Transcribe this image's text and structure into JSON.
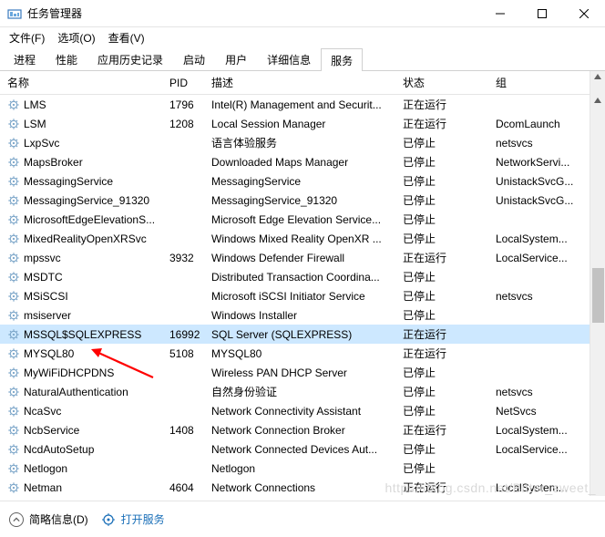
{
  "window": {
    "title": "任务管理器"
  },
  "menu": {
    "file": "文件(F)",
    "options": "选项(O)",
    "view": "查看(V)"
  },
  "tabs": {
    "items": [
      "进程",
      "性能",
      "应用历史记录",
      "启动",
      "用户",
      "详细信息",
      "服务"
    ],
    "activeIndex": 6
  },
  "columns": {
    "name": "名称",
    "pid": "PID",
    "desc": "描述",
    "status": "状态",
    "group": "组"
  },
  "rows": [
    {
      "name": "LMS",
      "pid": "1796",
      "desc": "Intel(R) Management and Securit...",
      "status": "正在运行",
      "group": ""
    },
    {
      "name": "LSM",
      "pid": "1208",
      "desc": "Local Session Manager",
      "status": "正在运行",
      "group": "DcomLaunch"
    },
    {
      "name": "LxpSvc",
      "pid": "",
      "desc": "语言体验服务",
      "status": "已停止",
      "group": "netsvcs"
    },
    {
      "name": "MapsBroker",
      "pid": "",
      "desc": "Downloaded Maps Manager",
      "status": "已停止",
      "group": "NetworkServi..."
    },
    {
      "name": "MessagingService",
      "pid": "",
      "desc": "MessagingService",
      "status": "已停止",
      "group": "UnistackSvcG..."
    },
    {
      "name": "MessagingService_91320",
      "pid": "",
      "desc": "MessagingService_91320",
      "status": "已停止",
      "group": "UnistackSvcG..."
    },
    {
      "name": "MicrosoftEdgeElevationS...",
      "pid": "",
      "desc": "Microsoft Edge Elevation Service...",
      "status": "已停止",
      "group": ""
    },
    {
      "name": "MixedRealityOpenXRSvc",
      "pid": "",
      "desc": "Windows Mixed Reality OpenXR ...",
      "status": "已停止",
      "group": "LocalSystem..."
    },
    {
      "name": "mpssvc",
      "pid": "3932",
      "desc": "Windows Defender Firewall",
      "status": "正在运行",
      "group": "LocalService..."
    },
    {
      "name": "MSDTC",
      "pid": "",
      "desc": "Distributed Transaction Coordina...",
      "status": "已停止",
      "group": ""
    },
    {
      "name": "MSiSCSI",
      "pid": "",
      "desc": "Microsoft iSCSI Initiator Service",
      "status": "已停止",
      "group": "netsvcs"
    },
    {
      "name": "msiserver",
      "pid": "",
      "desc": "Windows Installer",
      "status": "已停止",
      "group": ""
    },
    {
      "name": "MSSQL$SQLEXPRESS",
      "pid": "16992",
      "desc": "SQL Server (SQLEXPRESS)",
      "status": "正在运行",
      "group": "",
      "selected": true
    },
    {
      "name": "MYSQL80",
      "pid": "5108",
      "desc": "MYSQL80",
      "status": "正在运行",
      "group": ""
    },
    {
      "name": "MyWiFiDHCPDNS",
      "pid": "",
      "desc": "Wireless PAN DHCP Server",
      "status": "已停止",
      "group": ""
    },
    {
      "name": "NaturalAuthentication",
      "pid": "",
      "desc": "自然身份验证",
      "status": "已停止",
      "group": "netsvcs"
    },
    {
      "name": "NcaSvc",
      "pid": "",
      "desc": "Network Connectivity Assistant",
      "status": "已停止",
      "group": "NetSvcs"
    },
    {
      "name": "NcbService",
      "pid": "1408",
      "desc": "Network Connection Broker",
      "status": "正在运行",
      "group": "LocalSystem..."
    },
    {
      "name": "NcdAutoSetup",
      "pid": "",
      "desc": "Network Connected Devices Aut...",
      "status": "已停止",
      "group": "LocalService..."
    },
    {
      "name": "Netlogon",
      "pid": "",
      "desc": "Netlogon",
      "status": "已停止",
      "group": ""
    },
    {
      "name": "Netman",
      "pid": "4604",
      "desc": "Network Connections",
      "status": "正在运行",
      "group": "LocalSystem..."
    }
  ],
  "statusbar": {
    "brief": "简略信息(D)",
    "openServices": "打开服务"
  },
  "watermark": "https://blog.csdn.net/Bitter_sweet_"
}
